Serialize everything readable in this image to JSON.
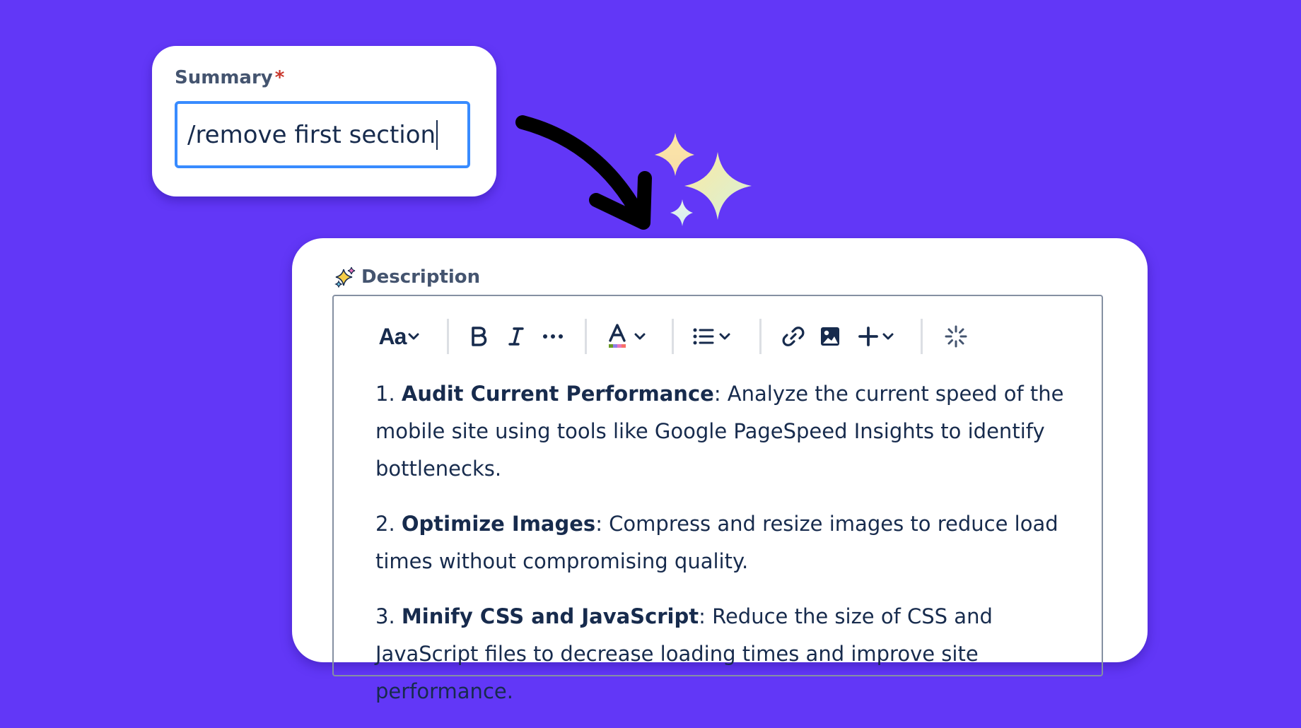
{
  "summary": {
    "label": "Summary",
    "required_marker": "*",
    "input_value": "/remove first section"
  },
  "description": {
    "label": "Description",
    "header_icon": "sparkles-icon",
    "toolbar": {
      "text_style_label": "Aa",
      "icons": [
        "chevron-down-icon",
        "bold-icon",
        "italic-icon",
        "more-formatting-icon",
        "text-color-icon",
        "bullet-list-icon",
        "link-icon",
        "image-icon",
        "plus-icon",
        "ai-loading-icon"
      ]
    },
    "items": [
      {
        "number": "1.",
        "title": "Audit Current Performance",
        "text": ": Analyze the current speed of the mobile site using tools like Google PageSpeed Insights to identify bottlenecks."
      },
      {
        "number": "2.",
        "title": "Optimize Images",
        "text": ": Compress and resize images to reduce load times without compromising quality."
      },
      {
        "number": "3.",
        "title": "Minify CSS and JavaScript",
        "text": ": Reduce the size of CSS and JavaScript files to decrease loading times and improve site performance."
      }
    ]
  },
  "colors": {
    "background": "#6237F7",
    "card": "#ffffff",
    "label_text": "#44546F",
    "body_text": "#172B4D",
    "input_focus_border": "#388BFF",
    "required_star": "#C9372C",
    "editor_border": "#8590A2"
  }
}
